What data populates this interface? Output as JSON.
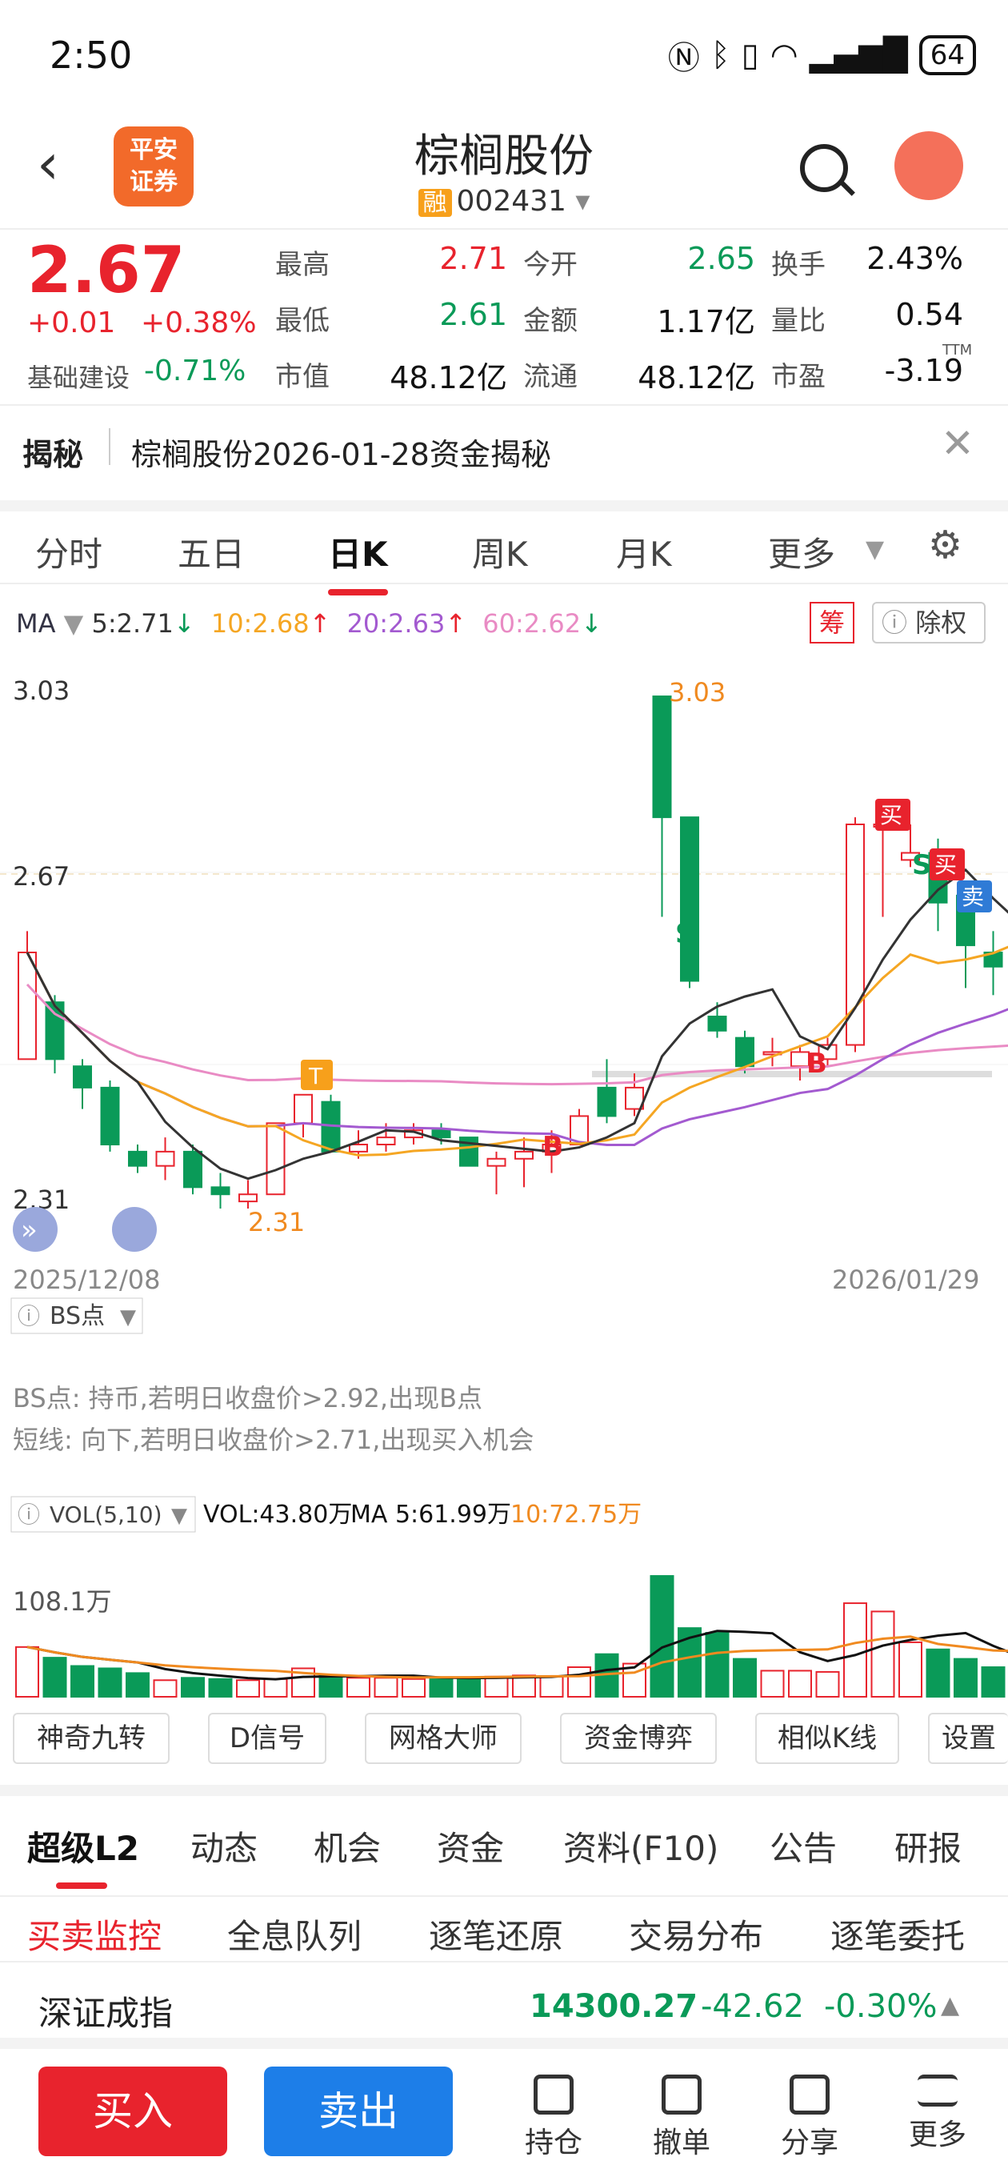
{
  "status": {
    "time": "2:50",
    "battery": "64"
  },
  "header": {
    "broker_logo": "平安\n证券",
    "name": "棕榈股份",
    "code": "002431",
    "margin_tag": "融"
  },
  "quote": {
    "price": "2.67",
    "change": "+0.01",
    "change_pct": "+0.38%",
    "sector": "基础建设",
    "sector_pct": "-0.71%",
    "fields": [
      {
        "label": "最高",
        "value": "2.71",
        "color": "red"
      },
      {
        "label": "今开",
        "value": "2.65",
        "color": "green"
      },
      {
        "label": "换手",
        "value": "2.43%",
        "color": "black"
      },
      {
        "label": "最低",
        "value": "2.61",
        "color": "green"
      },
      {
        "label": "金额",
        "value": "1.17亿",
        "color": "black"
      },
      {
        "label": "量比",
        "value": "0.54",
        "color": "black"
      },
      {
        "label": "市值",
        "value": "48.12亿",
        "color": "black"
      },
      {
        "label": "流通",
        "value": "48.12亿",
        "color": "black"
      },
      {
        "label": "市盈",
        "value": "-3.19",
        "color": "black"
      }
    ],
    "pe_sup": "TTM"
  },
  "reveal": {
    "label": "揭秘",
    "text": "棕榈股份2026-01-28资金揭秘"
  },
  "tabs": [
    "分时",
    "五日",
    "日K",
    "周K",
    "月K",
    "更多"
  ],
  "ma": {
    "label": "MA",
    "ma5": "5:2.71",
    "ma10": "10:2.68",
    "ma20": "20:2.63",
    "ma60": "60:2.62",
    "chip": "筹",
    "fq": "除权"
  },
  "chart": {
    "high_label": "3.03",
    "low_label": "2.31",
    "mid_label": "2.67",
    "peak_label": "3.03",
    "trough_label": "2.31",
    "date_start": "2025/12/08",
    "date_end": "2026/01/29",
    "t_mark": "T",
    "s_mark": "S",
    "b_mark": "B",
    "buy": "买",
    "sell": "卖"
  },
  "bs": {
    "selector": "BS点",
    "line1": "BS点: 持币,若明日收盘价>2.92,出现B点",
    "line2": "短线: 向下,若明日收盘价>2.71,出现买入机会"
  },
  "vol": {
    "selector": "VOL(5,10)",
    "vol": "VOL:43.80万",
    "ma5": "MA 5:61.99万",
    "ma10": "10:72.75万",
    "max": "108.1万"
  },
  "tools": [
    "神奇九转",
    "D信号",
    "网格大师",
    "资金博弈",
    "相似K线",
    "设置"
  ],
  "bottom_tabs": [
    "超级L2",
    "动态",
    "机会",
    "资金",
    "资料(F10)",
    "公告",
    "研报"
  ],
  "sub_tabs": [
    "买卖监控",
    "全息队列",
    "逐笔还原",
    "交易分布",
    "逐笔委托"
  ],
  "index": {
    "name": "深证成指",
    "value": "14300.27",
    "change": "-42.62",
    "pct": "-0.30%"
  },
  "actions": {
    "buy": "买入",
    "sell": "卖出",
    "items": [
      "持仓",
      "撤单",
      "分享",
      "更多"
    ]
  },
  "colors": {
    "up": "#e8232d",
    "down": "#0a9a58",
    "ma5": "#333333",
    "ma10": "#f5a623",
    "ma20": "#a35ad0",
    "ma60": "#e98bc4"
  },
  "candles": [
    {
      "o": 2.52,
      "c": 2.67,
      "h": 2.7,
      "l": 2.52
    },
    {
      "o": 2.6,
      "c": 2.52,
      "h": 2.61,
      "l": 2.5
    },
    {
      "o": 2.51,
      "c": 2.48,
      "h": 2.52,
      "l": 2.45
    },
    {
      "o": 2.48,
      "c": 2.4,
      "h": 2.49,
      "l": 2.39
    },
    {
      "o": 2.39,
      "c": 2.37,
      "h": 2.4,
      "l": 2.36
    },
    {
      "o": 2.37,
      "c": 2.39,
      "h": 2.41,
      "l": 2.35
    },
    {
      "o": 2.39,
      "c": 2.34,
      "h": 2.4,
      "l": 2.33
    },
    {
      "o": 2.34,
      "c": 2.33,
      "h": 2.36,
      "l": 2.31
    },
    {
      "o": 2.32,
      "c": 2.33,
      "h": 2.35,
      "l": 2.31
    },
    {
      "o": 2.33,
      "c": 2.43,
      "h": 2.43,
      "l": 2.33
    },
    {
      "o": 2.43,
      "c": 2.47,
      "h": 2.47,
      "l": 2.41
    },
    {
      "o": 2.46,
      "c": 2.39,
      "h": 2.47,
      "l": 2.39
    },
    {
      "o": 2.39,
      "c": 2.4,
      "h": 2.42,
      "l": 2.38
    },
    {
      "o": 2.4,
      "c": 2.41,
      "h": 2.43,
      "l": 2.39
    },
    {
      "o": 2.41,
      "c": 2.42,
      "h": 2.43,
      "l": 2.4
    },
    {
      "o": 2.42,
      "c": 2.41,
      "h": 2.43,
      "l": 2.4
    },
    {
      "o": 2.41,
      "c": 2.37,
      "h": 2.41,
      "l": 2.37
    },
    {
      "o": 2.37,
      "c": 2.38,
      "h": 2.39,
      "l": 2.33
    },
    {
      "o": 2.38,
      "c": 2.39,
      "h": 2.41,
      "l": 2.34
    },
    {
      "o": 2.39,
      "c": 2.4,
      "h": 2.42,
      "l": 2.36
    },
    {
      "o": 2.4,
      "c": 2.44,
      "h": 2.45,
      "l": 2.4
    },
    {
      "o": 2.48,
      "c": 2.44,
      "h": 2.52,
      "l": 2.43
    },
    {
      "o": 2.45,
      "c": 2.48,
      "h": 2.5,
      "l": 2.44
    },
    {
      "o": 3.03,
      "c": 2.86,
      "h": 3.03,
      "l": 2.72
    },
    {
      "o": 2.86,
      "c": 2.63,
      "h": 2.86,
      "l": 2.62
    },
    {
      "o": 2.58,
      "c": 2.56,
      "h": 2.6,
      "l": 2.55
    },
    {
      "o": 2.55,
      "c": 2.51,
      "h": 2.56,
      "l": 2.5
    },
    {
      "o": 2.53,
      "c": 2.53,
      "h": 2.55,
      "l": 2.51
    },
    {
      "o": 2.51,
      "c": 2.53,
      "h": 2.54,
      "l": 2.49
    },
    {
      "o": 2.52,
      "c": 2.54,
      "h": 2.55,
      "l": 2.51
    },
    {
      "o": 2.54,
      "c": 2.85,
      "h": 2.86,
      "l": 2.53
    },
    {
      "o": 2.85,
      "c": 2.85,
      "h": 2.86,
      "l": 2.72
    },
    {
      "o": 2.8,
      "c": 2.81,
      "h": 2.85,
      "l": 2.79
    },
    {
      "o": 2.81,
      "c": 2.74,
      "h": 2.83,
      "l": 2.7
    },
    {
      "o": 2.75,
      "c": 2.68,
      "h": 2.76,
      "l": 2.62
    },
    {
      "o": 2.67,
      "c": 2.65,
      "h": 2.7,
      "l": 2.61
    },
    {
      "o": 2.65,
      "c": 2.67,
      "h": 2.71,
      "l": 2.61
    }
  ],
  "volumes": [
    0.42,
    0.33,
    0.26,
    0.24,
    0.2,
    0.14,
    0.16,
    0.15,
    0.14,
    0.15,
    0.24,
    0.18,
    0.16,
    0.16,
    0.15,
    0.16,
    0.16,
    0.17,
    0.18,
    0.17,
    0.25,
    0.36,
    0.28,
    1.02,
    0.58,
    0.54,
    0.32,
    0.22,
    0.22,
    0.21,
    0.79,
    0.72,
    0.46,
    0.4,
    0.32,
    0.25,
    0.26
  ]
}
